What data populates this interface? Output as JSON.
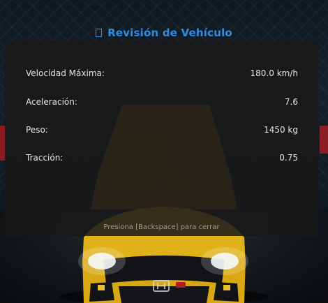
{
  "title": "Revisión de Vehículo",
  "title_icon": "box-icon",
  "stats": [
    {
      "label": "Velocidad Máxima:",
      "value": "180.0 km/h"
    },
    {
      "label": "Aceleración:",
      "value": "7.6"
    },
    {
      "label": "Peso:",
      "value": "1450 kg"
    },
    {
      "label": "Tracción:",
      "value": "0.75"
    }
  ],
  "hint": "Presiona [Backspace] para cerrar",
  "colors": {
    "title": "#2b8fe6",
    "panel": "#181818",
    "car_body": "#e0b21a"
  },
  "car_badge_icon": "honda-logo-icon"
}
